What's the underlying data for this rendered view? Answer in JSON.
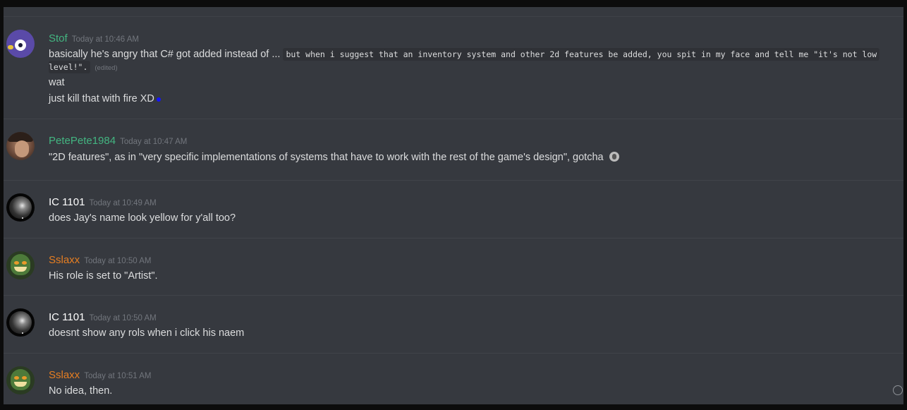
{
  "messages": [
    {
      "author": "Stof",
      "author_color": "#43b581",
      "timestamp": "Today at 10:46 AM",
      "lines": {
        "l1_text": "basically he's angry that C# got added instead of ...",
        "l1_code": "but when i suggest that an inventory system and other 2d features be added, you spit in my face and tell me \"it's not low",
        "l2_code": "level!\".",
        "l2_edited": "(edited)",
        "l3": "wat",
        "l4": "just kill that with fire XD"
      },
      "avatar_icon": "bird-eye-avatar"
    },
    {
      "author": "PetePete1984",
      "author_color": "#43b581",
      "timestamp": "Today at 10:47 AM",
      "text": "\"2D features\", as in \"very specific implementations of systems that have to work with the rest of the game's design\", gotcha",
      "avatar_icon": "photo-man-avatar"
    },
    {
      "author": "IC 1101",
      "author_color": "#ffffff",
      "timestamp": "Today at 10:49 AM",
      "text": "does Jay's name look yellow for y'all too?",
      "avatar_icon": "dark-sphere-avatar"
    },
    {
      "author": "Sslaxx",
      "author_color": "#e67e22",
      "timestamp": "Today at 10:50 AM",
      "text": "His role is set to \"Artist\".",
      "avatar_icon": "green-creature-avatar"
    },
    {
      "author": "IC 1101",
      "author_color": "#ffffff",
      "timestamp": "Today at 10:50 AM",
      "text": "doesnt show any rols when i click his naem",
      "avatar_icon": "dark-sphere-avatar"
    },
    {
      "author": "Sslaxx",
      "author_color": "#e67e22",
      "timestamp": "Today at 10:51 AM",
      "text": "No idea, then.",
      "avatar_icon": "green-creature-avatar"
    }
  ],
  "colors": {
    "background": "#36393f",
    "text": "#dcddde",
    "timestamp": "#72767d",
    "divider": "#41444a"
  },
  "icons": {
    "emoji_picker": "smiley-icon",
    "inline_emoji": "face-emoji-icon"
  }
}
